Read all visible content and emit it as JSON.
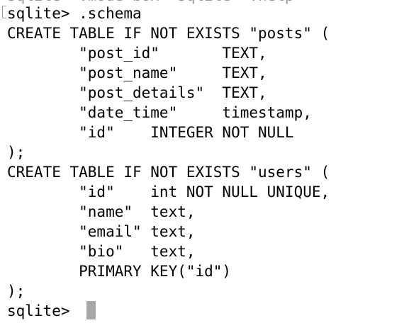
{
  "terminal": {
    "partial_top_line": "sqlite> .mode box  sqlite> .help",
    "lines": [
      "sqlite> .schema",
      "CREATE TABLE IF NOT EXISTS \"posts\" (",
      "        \"post_id\"       TEXT,",
      "        \"post_name\"     TEXT,",
      "        \"post_details\"  TEXT,",
      "        \"date_time\"     timestamp,",
      "        \"id\"    INTEGER NOT NULL",
      ");",
      "CREATE TABLE IF NOT EXISTS \"users\" (",
      "        \"id\"    int NOT NULL UNIQUE,",
      "        \"name\"  text,",
      "        \"email\" text,",
      "        \"bio\"   text,",
      "        PRIMARY KEY(\"id\")",
      ");",
      "sqlite> "
    ],
    "cursor_color": "#a8a8a8",
    "text_color": "#000000",
    "background_color": "#ffffff"
  }
}
